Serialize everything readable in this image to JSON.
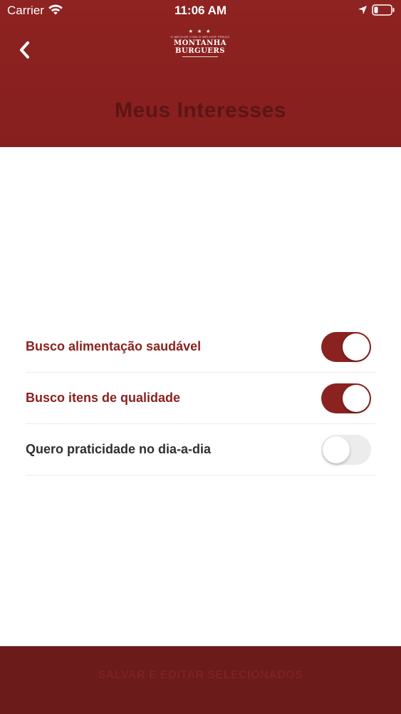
{
  "colors": {
    "brand": "#8a2220",
    "header_bg": "#8e2321",
    "footer_bg": "#6a1b1a",
    "toggle_off": "#ececec"
  },
  "status_bar": {
    "carrier": "Carrier",
    "time": "11:06 AM",
    "icons": [
      "wifi-icon",
      "location-arrow-icon",
      "battery-icon"
    ]
  },
  "header": {
    "back_icon": "chevron-left-icon",
    "logo": {
      "stars": "★ ★ ★",
      "tagline": "O MELHOR COM O MELHOR PREÇO",
      "line1": "MONTANHA",
      "line2": "BURGUERS"
    },
    "title": "Meus Interesses"
  },
  "interests": [
    {
      "label": "Busco alimentação saudável",
      "enabled": true
    },
    {
      "label": "Busco itens de qualidade",
      "enabled": true
    },
    {
      "label": "Quero praticidade no dia-a-dia",
      "enabled": false
    }
  ],
  "footer": {
    "save_label": "SALVAR E EDITAR SELECIONADOS"
  }
}
